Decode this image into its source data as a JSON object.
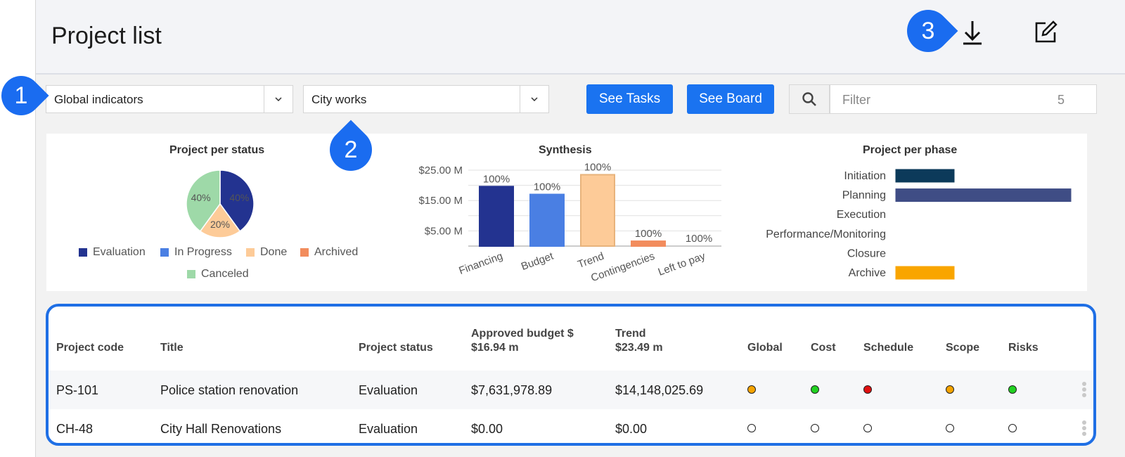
{
  "header": {
    "title": "Project list"
  },
  "toolbar": {
    "indicator_select": "Global indicators",
    "portfolio_select": "City works",
    "see_tasks": "See Tasks",
    "see_board": "See Board",
    "filter_placeholder": "Filter",
    "filter_count": "5"
  },
  "callouts": [
    "1",
    "2",
    "3"
  ],
  "icons": {
    "download": "download-icon",
    "edit": "edit-icon",
    "search": "search-icon",
    "caret": "chevron-down-icon"
  },
  "charts": {
    "status": {
      "title": "Project per status",
      "slices": [
        {
          "name": "Evaluation",
          "value": 40,
          "label": "40%",
          "color": "#233390"
        },
        {
          "name": "In Progress",
          "value": 0,
          "label": "",
          "color": "#4a7fe3"
        },
        {
          "name": "Done",
          "value": 20,
          "label": "20%",
          "color": "#fdcb98"
        },
        {
          "name": "Archived",
          "value": 0,
          "label": "",
          "color": "#f28c5d"
        },
        {
          "name": "Canceled",
          "value": 40,
          "label": "40%",
          "color": "#9ed9a8"
        }
      ]
    },
    "synthesis": {
      "title": "Synthesis",
      "yticks": [
        "$25.00 M",
        "$15.00 M",
        "$5.00 M"
      ],
      "bars": [
        {
          "category": "Financing",
          "value": 19.6,
          "label": "100%",
          "fill": "#233390",
          "stroke": "#233390"
        },
        {
          "category": "Budget",
          "value": 17.0,
          "label": "100%",
          "fill": "#4a7fe3",
          "stroke": "#4a7fe3"
        },
        {
          "category": "Trend",
          "value": 23.5,
          "label": "100%",
          "fill": "#fdcb98",
          "stroke": "#e8b37c"
        },
        {
          "category": "Contingencies",
          "value": 1.6,
          "label": "100%",
          "fill": "#f28c5d",
          "stroke": "#f28c5d"
        },
        {
          "category": "Left to pay",
          "value": 0,
          "label": "100%",
          "fill": "#cccccc",
          "stroke": "#cccccc"
        }
      ]
    },
    "phase": {
      "title": "Project per phase",
      "rows": [
        {
          "name": "Initiation",
          "value": 1,
          "color": "#0c3a5a"
        },
        {
          "name": "Planning",
          "value": 3,
          "color": "#3f4d85"
        },
        {
          "name": "Execution",
          "value": 0,
          "color": "#999999"
        },
        {
          "name": "Performance/Monitoring",
          "value": 0,
          "color": "#999999"
        },
        {
          "name": "Closure",
          "value": 0,
          "color": "#999999"
        },
        {
          "name": "Archive",
          "value": 1,
          "color": "#f9a500"
        }
      ]
    }
  },
  "chart_data": [
    {
      "type": "pie",
      "title": "Project per status",
      "categories": [
        "Evaluation",
        "In Progress",
        "Done",
        "Archived",
        "Canceled"
      ],
      "values": [
        40,
        0,
        20,
        0,
        40
      ],
      "legend": "bottom"
    },
    {
      "type": "bar",
      "title": "Synthesis",
      "categories": [
        "Financing",
        "Budget",
        "Trend",
        "Contingencies",
        "Left to pay"
      ],
      "values": [
        19.6,
        17.0,
        23.5,
        1.6,
        0
      ],
      "yticks": [
        "$25.00 M",
        "$15.00 M",
        "$5.00 M"
      ],
      "grid": true
    },
    {
      "type": "bar",
      "title": "Project per phase",
      "orientation": "horizontal",
      "categories": [
        "Initiation",
        "Planning",
        "Execution",
        "Performance/Monitoring",
        "Closure",
        "Archive"
      ],
      "values": [
        1,
        3,
        0,
        0,
        0,
        1
      ]
    }
  ],
  "table": {
    "headers": {
      "code": "Project code",
      "title": "Title",
      "status": "Project status",
      "budget": "Approved budget $",
      "budget_total": "$16.94 m",
      "trend": "Trend",
      "trend_total": "$23.49 m",
      "global": "Global",
      "cost": "Cost",
      "schedule": "Schedule",
      "scope": "Scope",
      "risks": "Risks"
    },
    "rows": [
      {
        "code": "PS-101",
        "title": "Police station renovation",
        "status": "Evaluation",
        "budget": "$7,631,978.89",
        "trend": "$14,148,025.69",
        "indicators": [
          "orange",
          "green",
          "red",
          "orange",
          "green"
        ]
      },
      {
        "code": "CH-48",
        "title": "City Hall Renovations",
        "status": "Evaluation",
        "budget": "$0.00",
        "trend": "$0.00",
        "indicators": [
          "empty",
          "empty",
          "empty",
          "empty",
          "empty"
        ]
      }
    ]
  },
  "colors": {
    "accent": "#1a73f0",
    "orange": "#f5a300",
    "green": "#21d121",
    "red": "#e01010",
    "empty": "#ffffff"
  }
}
